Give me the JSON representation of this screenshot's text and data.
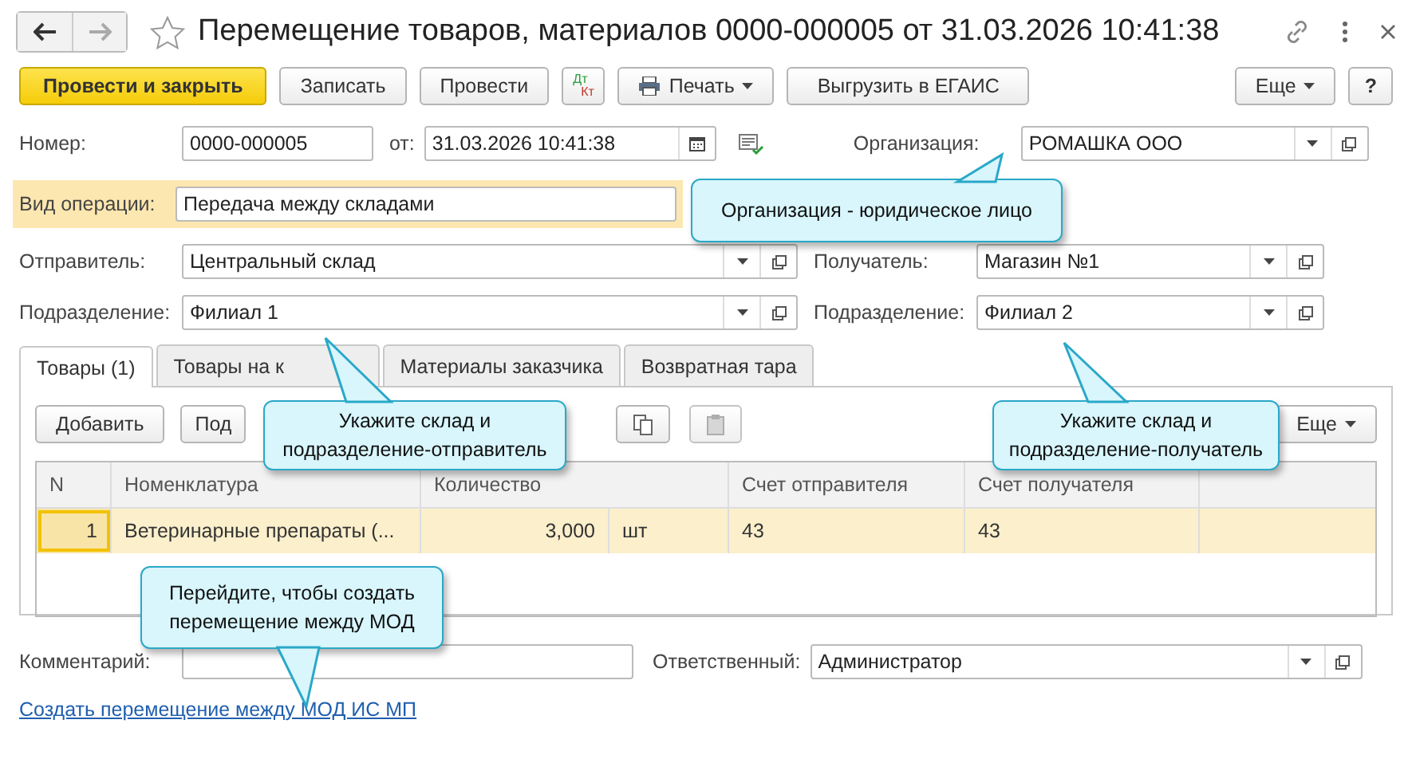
{
  "window": {
    "title": "Перемещение товаров, материалов 0000-000005 от 31.03.2026 10:41:38"
  },
  "toolbar": {
    "post_close": "Провести и закрыть",
    "save": "Записать",
    "post": "Провести",
    "dtkt_top": "Дт",
    "dtkt_bottom": "Кт",
    "print": "Печать",
    "egais": "Выгрузить в ЕГАИС",
    "more": "Еще",
    "help": "?"
  },
  "header": {
    "number": {
      "label": "Номер:",
      "value": "0000-000005"
    },
    "date": {
      "label": "от:",
      "value": "31.03.2026 10:41:38"
    },
    "organization": {
      "label": "Организация:",
      "value": "РОМАШКА ООО"
    },
    "operation": {
      "label": "Вид операции:",
      "value": "Передача между складами"
    },
    "sender": {
      "label": "Отправитель:",
      "value": "Центральный склад"
    },
    "receiver": {
      "label": "Получатель:",
      "value": "Магазин №1"
    },
    "sender_division": {
      "label": "Подразделение:",
      "value": "Филиал 1"
    },
    "receiver_division": {
      "label": "Подразделение:",
      "value": "Филиал 2"
    }
  },
  "tabs": [
    {
      "label": "Товары (1)",
      "selected": true
    },
    {
      "label": "Товары на к",
      "selected": false
    },
    {
      "label": "Материалы заказчика",
      "selected": false
    },
    {
      "label": "Возвратная тара",
      "selected": false
    }
  ],
  "table_toolbar": {
    "add": "Добавить",
    "pick": "Под",
    "more": "Еще"
  },
  "table": {
    "columns": [
      "N",
      "Номенклатура",
      "Количество",
      "Счет отправителя",
      "Счет получателя"
    ],
    "rows": [
      {
        "n": "1",
        "item": "Ветеринарные препараты (...",
        "quantity": "3,000",
        "unit": "шт",
        "account_from": "43",
        "account_to": "43",
        "selected": true
      }
    ]
  },
  "footer": {
    "comment": {
      "label": "Комментарий:"
    },
    "responsible": {
      "label": "Ответственный:",
      "value": "Администратор"
    },
    "link": "Создать перемещение между МОД ИС МП"
  },
  "callouts": [
    {
      "kind": "organization",
      "text": "Организация - юридическое лицо"
    },
    {
      "kind": "sender",
      "text": "Укажите склад и\nподразделение-отправитель"
    },
    {
      "kind": "receiver",
      "text": "Укажите склад и\nподразделение-получатель"
    },
    {
      "kind": "link",
      "text": "Перейдите, чтобы создать\nперемещение между МОД"
    }
  ]
}
